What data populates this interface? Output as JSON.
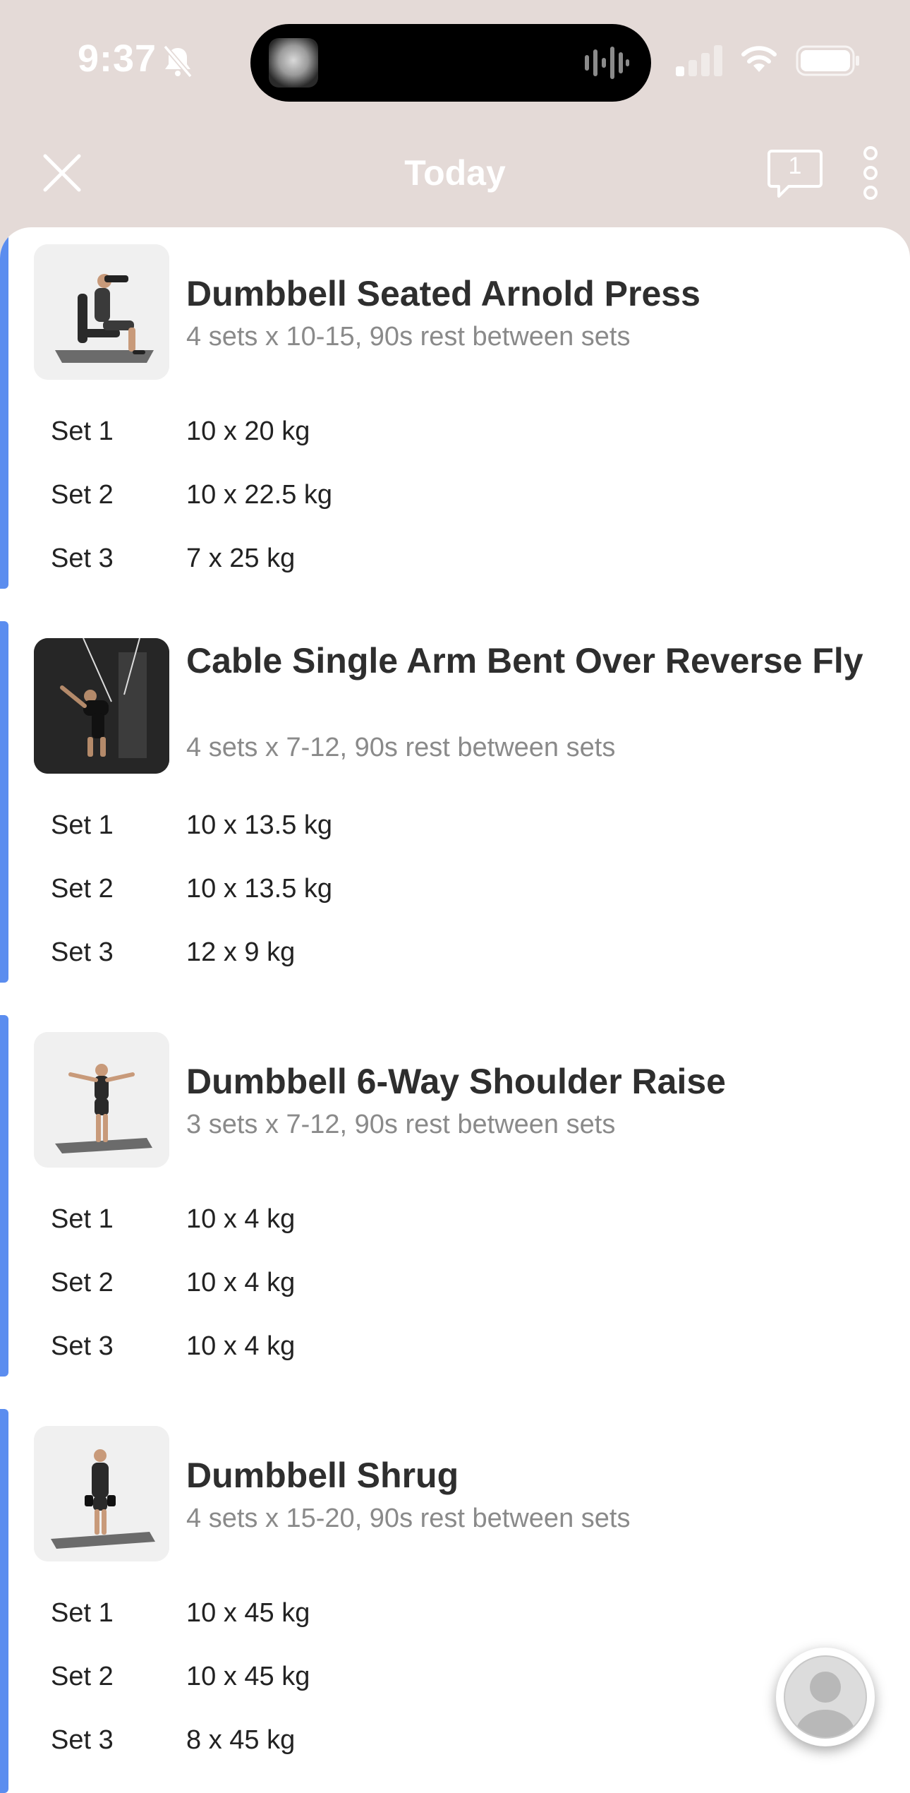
{
  "status_bar": {
    "time": "9:37",
    "icons": [
      "bell-slash-icon",
      "signal-icon",
      "wifi-icon",
      "battery-icon"
    ]
  },
  "nav": {
    "title": "Today",
    "comment_count": "1",
    "icons": [
      "close-icon",
      "comment-icon",
      "more-vertical-icon"
    ]
  },
  "colors": {
    "header_bg": "#e4dad7",
    "accent": "#5b8def",
    "meta_text": "#8a8a8a"
  },
  "exercises": [
    {
      "name": "Dumbbell Seated Arnold Press",
      "meta": "4 sets x 10-15, 90s rest between sets",
      "sets": [
        {
          "label": "Set 1",
          "value": "10 x 20 kg"
        },
        {
          "label": "Set 2",
          "value": "10 x 22.5 kg"
        },
        {
          "label": "Set 3",
          "value": "7 x 25 kg"
        }
      ]
    },
    {
      "name": "Cable Single Arm Bent Over Reverse Fly",
      "meta": "4 sets x 7-12, 90s rest between sets",
      "sets": [
        {
          "label": "Set 1",
          "value": "10 x 13.5 kg"
        },
        {
          "label": "Set 2",
          "value": "10 x 13.5 kg"
        },
        {
          "label": "Set 3",
          "value": "12 x 9 kg"
        }
      ]
    },
    {
      "name": "Dumbbell 6-Way Shoulder Raise",
      "meta": "3 sets x 7-12, 90s rest between sets",
      "sets": [
        {
          "label": "Set 1",
          "value": "10 x 4 kg"
        },
        {
          "label": "Set 2",
          "value": "10 x 4 kg"
        },
        {
          "label": "Set 3",
          "value": "10 x 4 kg"
        }
      ]
    },
    {
      "name": "Dumbbell Shrug",
      "meta": "4 sets x 15-20, 90s rest between sets",
      "sets": [
        {
          "label": "Set 1",
          "value": "10 x 45 kg"
        },
        {
          "label": "Set 2",
          "value": "10 x 45 kg"
        },
        {
          "label": "Set 3",
          "value": "8 x 45 kg"
        }
      ]
    }
  ]
}
